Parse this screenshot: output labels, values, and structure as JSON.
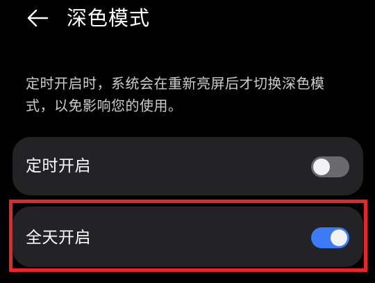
{
  "header": {
    "back_icon": "arrow-left-icon",
    "title": "深色模式"
  },
  "description": "定时开启时，系统会在重新亮屏后才切换深色模式，以免影响您的使用。",
  "settings": [
    {
      "label": "定时开启",
      "toggle_on": false
    },
    {
      "label": "全天开启",
      "toggle_on": true
    }
  ],
  "colors": {
    "background": "#000000",
    "card": "#232325",
    "toggle_on": "#3b7cf6",
    "toggle_off": "#6a6a6c",
    "highlight": "#e8262a"
  }
}
